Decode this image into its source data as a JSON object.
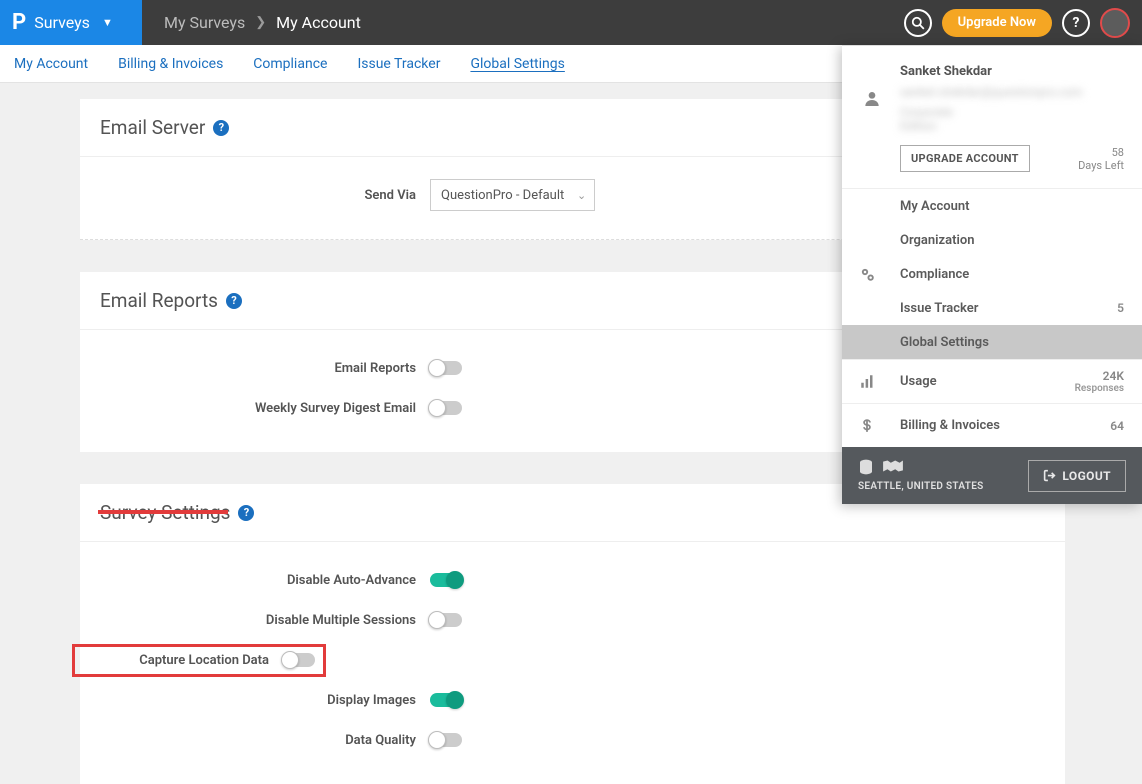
{
  "topbar": {
    "brand_glyph": "P",
    "brand_label": "Surveys",
    "breadcrumb_root": "My Surveys",
    "breadcrumb_current": "My Account",
    "upgrade_label": "Upgrade Now",
    "help_glyph": "?"
  },
  "subnav": {
    "items": [
      {
        "label": "My Account"
      },
      {
        "label": "Billing & Invoices"
      },
      {
        "label": "Compliance"
      },
      {
        "label": "Issue Tracker"
      },
      {
        "label": "Global Settings",
        "active": true
      }
    ]
  },
  "panels": {
    "email_server": {
      "title": "Email Server",
      "send_via_label": "Send Via",
      "send_via_value": "QuestionPro - Default"
    },
    "email_reports": {
      "title": "Email Reports",
      "rows": [
        {
          "label": "Email Reports",
          "on": false
        },
        {
          "label": "Weekly Survey Digest Email",
          "on": false
        }
      ]
    },
    "survey_settings": {
      "title": "Survey Settings",
      "rows": [
        {
          "label": "Disable Auto-Advance",
          "on": true
        },
        {
          "label": "Disable Multiple Sessions",
          "on": false
        },
        {
          "label": "Capture Location Data",
          "on": false,
          "highlight": true
        },
        {
          "label": "Display Images",
          "on": true
        },
        {
          "label": "Data Quality",
          "on": false
        }
      ]
    }
  },
  "account_panel": {
    "user_name": "Sanket Shekdar",
    "blurred_line1": "sanket.shekdar@questionpro.com",
    "blurred_line2": "Corporate Edition",
    "days_left_value": "58",
    "days_left_label": "Days Left",
    "upgrade_account_label": "UPGRADE ACCOUNT",
    "menu": [
      {
        "label": "My Account"
      },
      {
        "label": "Organization"
      },
      {
        "label": "Compliance",
        "icon": "gears"
      },
      {
        "label": "Issue Tracker",
        "value": "5"
      },
      {
        "label": "Global Settings",
        "selected": true
      },
      {
        "label": "Usage",
        "icon": "bars",
        "value": "24K",
        "sub": "Responses"
      },
      {
        "label": "Billing & Invoices",
        "icon": "dollar",
        "value": "64"
      }
    ],
    "footer_location": "SEATTLE, UNITED STATES",
    "logout_label": "LOGOUT"
  }
}
